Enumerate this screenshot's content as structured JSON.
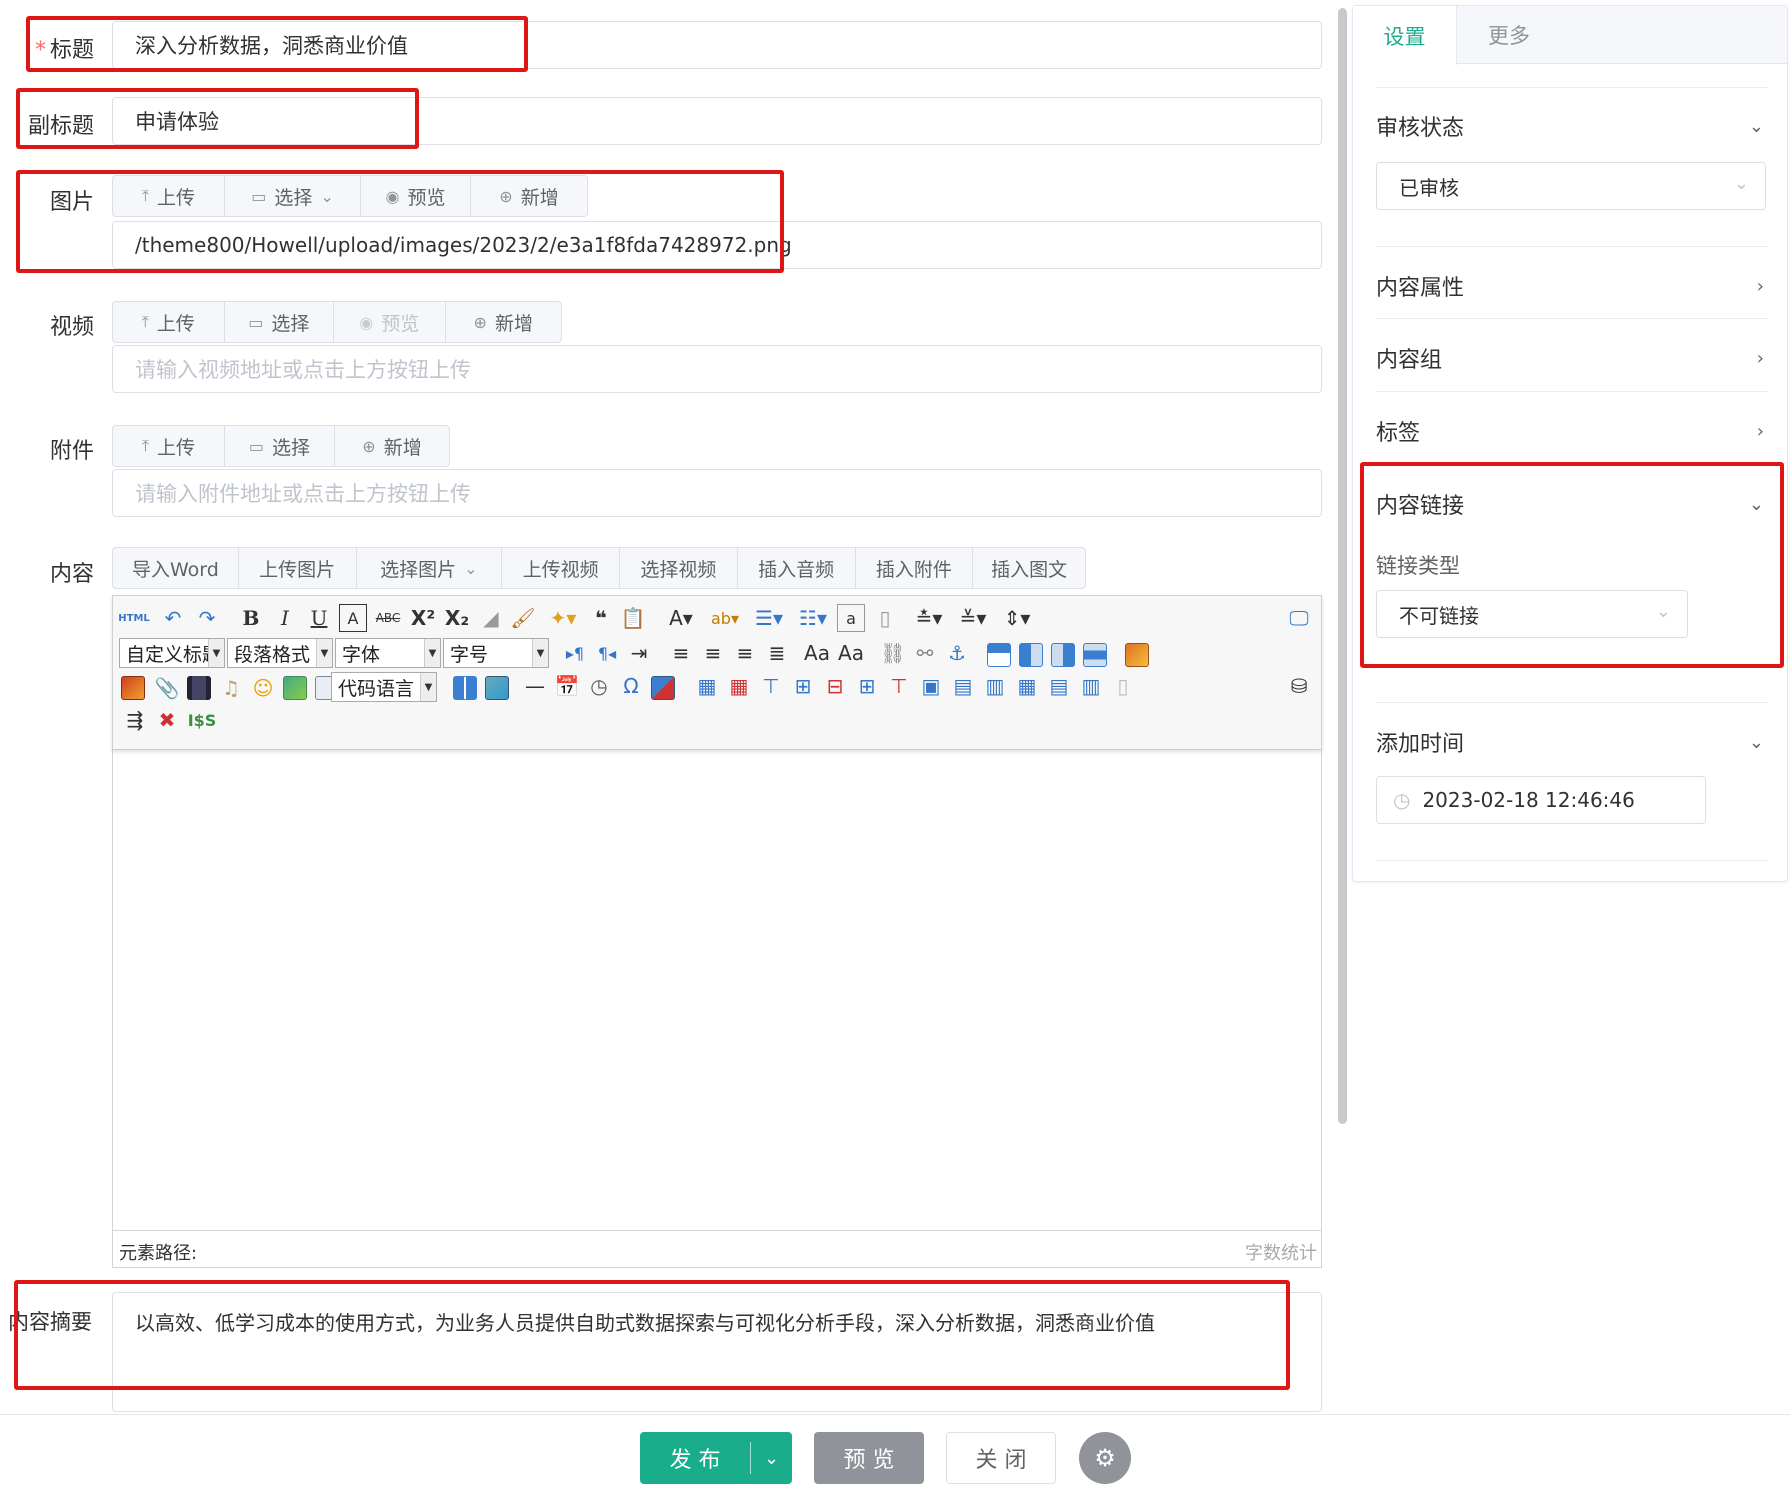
{
  "form": {
    "title": {
      "label": "标题",
      "required": "*",
      "value": "深入分析数据，洞悉商业价值"
    },
    "subtitle": {
      "label": "副标题",
      "value": "申请体验"
    },
    "image": {
      "label": "图片",
      "buttons": [
        "上传",
        "选择",
        "预览",
        "新增"
      ],
      "value": "/theme800/Howell/upload/images/2023/2/e3a1f8fda7428972.png"
    },
    "video": {
      "label": "视频",
      "buttons": [
        "上传",
        "选择",
        "预览",
        "新增"
      ],
      "placeholder": "请输入视频地址或点击上方按钮上传"
    },
    "attachment": {
      "label": "附件",
      "buttons": [
        "上传",
        "选择",
        "新增"
      ],
      "placeholder": "请输入附件地址或点击上方按钮上传"
    },
    "content": {
      "label": "内容",
      "buttons": [
        "导入Word",
        "上传图片",
        "选择图片",
        "上传视频",
        "选择视频",
        "插入音频",
        "插入附件",
        "插入图文"
      ]
    },
    "summary": {
      "label": "内容摘要",
      "value": "以高效、低学习成本的使用方式，为业务人员提供自助式数据探索与可视化分析手段，深入分析数据，洞悉商业价值"
    }
  },
  "editor": {
    "selects": {
      "custom_heading": "自定义标题",
      "paragraph": "段落格式",
      "font": "字体",
      "font_size": "字号",
      "code_lang": "代码语言"
    },
    "html_label": "HTML",
    "element_path": "元素路径:",
    "word_count": "字数统计"
  },
  "sidebar": {
    "tabs": [
      "设置",
      "更多"
    ],
    "review_status": {
      "label": "审核状态",
      "value": "已审核"
    },
    "content_attrs": "内容属性",
    "content_group": "内容组",
    "tags": "标签",
    "content_link": {
      "label": "内容链接",
      "link_type_label": "链接类型",
      "link_type_value": "不可链接"
    },
    "add_time": {
      "label": "添加时间",
      "value": "2023-02-18 12:46:46"
    }
  },
  "footer": {
    "publish": "发 布",
    "preview": "预 览",
    "close": "关 闭"
  },
  "colors": {
    "primary": "#1aad8c",
    "preview_btn": "#909399",
    "highlight": "#e01515"
  }
}
